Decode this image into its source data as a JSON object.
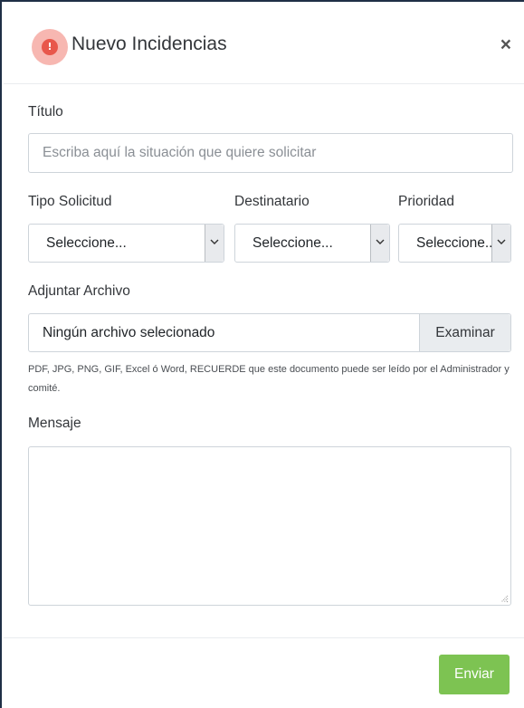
{
  "modal": {
    "title": "Nuevo Incidencias",
    "close_glyph": "×",
    "alert_glyph": "!",
    "accent_color": "#e8574b"
  },
  "form": {
    "titulo": {
      "label": "Título",
      "placeholder": "Escriba aquí la situación que quiere solicitar",
      "value": ""
    },
    "tipo_solicitud": {
      "label": "Tipo Solicitud",
      "selected": "Seleccione..."
    },
    "destinatario": {
      "label": "Destinatario",
      "selected": "Seleccione..."
    },
    "prioridad": {
      "label": "Prioridad",
      "selected": "Seleccione..."
    },
    "adjuntar": {
      "label": "Adjuntar Archivo",
      "file_status": "Ningún archivo selecionado",
      "browse_label": "Examinar",
      "help_text": "PDF, JPG, PNG, GIF, Excel ó Word, RECUERDE que este documento puede ser leído por el Administrador y comité."
    },
    "mensaje": {
      "label": "Mensaje",
      "value": ""
    }
  },
  "footer": {
    "send_label": "Enviar",
    "send_color": "#7dc352"
  },
  "icons": {
    "alert": "alert-icon",
    "close": "close-icon",
    "dropdown": "chevron-down-icon",
    "resize": "resize-grip-icon"
  }
}
